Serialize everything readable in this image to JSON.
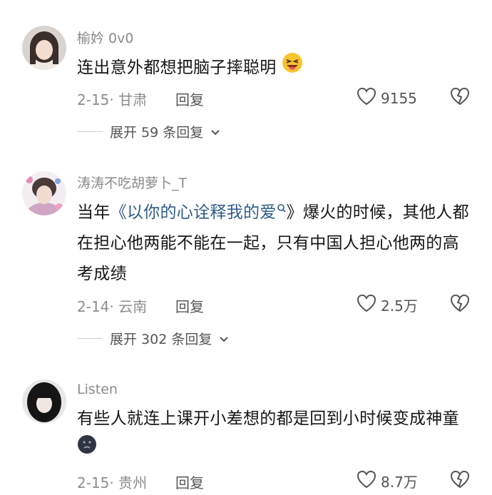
{
  "comments": [
    {
      "username": "榆妗 0v0",
      "text": "连出意外都想把脑子摔聪明",
      "date_location": "2-15· 甘肃",
      "reply_label": "回复",
      "likes": "9155",
      "expand_label": "展开 59 条回复"
    },
    {
      "username": "涛涛不吃胡萝卜_T",
      "text_prefix": "当年",
      "link_text": "《以你的心诠释我的爱",
      "text_suffix": "》爆火的时候，其他人都在担心他两能不能在一起，只有中国人担心他两的高考成绩",
      "date_location": "2-14· 云南",
      "reply_label": "回复",
      "likes": "2.5万",
      "expand_label": "展开 302 条回复"
    },
    {
      "username": "Listen",
      "text": "有些人就连上课开小差想的都是回到小时候变成神童",
      "date_location": "2-15· 贵州",
      "reply_label": "回复",
      "likes": "8.7万"
    }
  ],
  "icons": {
    "like": "heart-outline-icon",
    "dislike": "broken-heart-icon",
    "expand": "chevron-down-icon",
    "search": "search-icon"
  },
  "colors": {
    "link": "#2f5b8a",
    "muted": "#8b8b8b"
  }
}
